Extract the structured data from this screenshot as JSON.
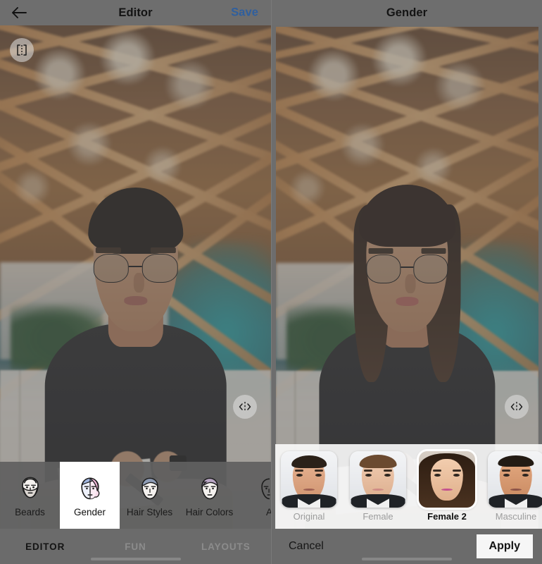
{
  "left_panel": {
    "header": {
      "back_icon": "back-arrow-icon",
      "title": "Editor",
      "save_label": "Save"
    },
    "canvas": {
      "crop_icon": "split-compare-icon",
      "compare_icon": "compare-slider-icon"
    },
    "tools": [
      {
        "label": "Beards",
        "icon": "face-beard-icon",
        "selected": false
      },
      {
        "label": "Gender",
        "icon": "face-gender-split-icon",
        "selected": true
      },
      {
        "label": "Hair Styles",
        "icon": "face-hairstyle-icon",
        "selected": false
      },
      {
        "label": "Hair Colors",
        "icon": "face-haircolor-icon",
        "selected": false
      },
      {
        "label": "A",
        "icon": "face-partial-icon",
        "selected": false
      }
    ],
    "tabs": [
      {
        "label": "EDITOR",
        "active": true
      },
      {
        "label": "FUN",
        "active": false
      },
      {
        "label": "LAYOUTS",
        "active": false
      }
    ]
  },
  "right_panel": {
    "header": {
      "title": "Gender"
    },
    "canvas": {
      "compare_icon": "compare-slider-icon"
    },
    "options": [
      {
        "label": "Original",
        "selected": false,
        "variant": "male-original"
      },
      {
        "label": "Female",
        "selected": false,
        "variant": "female-light"
      },
      {
        "label": "Female 2",
        "selected": true,
        "variant": "female-dark"
      },
      {
        "label": "Masculine",
        "selected": false,
        "variant": "male-masculine"
      }
    ],
    "actions": {
      "cancel_label": "Cancel",
      "apply_label": "Apply"
    }
  },
  "colors": {
    "overlay_gray": "#6d6d6d",
    "save_blue": "#2f5f9e",
    "active_text": "#141414",
    "idle_text": "#8c8c8c",
    "apply_bg": "#f6f6f6"
  }
}
